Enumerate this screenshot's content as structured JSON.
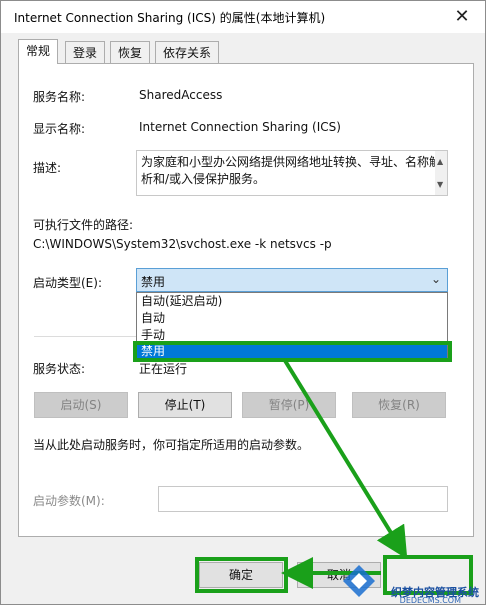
{
  "window": {
    "title": "Internet Connection Sharing (ICS) 的属性(本地计算机)",
    "close_glyph": "✕"
  },
  "tabs": [
    {
      "label": "常规",
      "active": true
    },
    {
      "label": "登录",
      "active": false
    },
    {
      "label": "恢复",
      "active": false
    },
    {
      "label": "依存关系",
      "active": false
    }
  ],
  "general": {
    "service_name_label": "服务名称:",
    "service_name_value": "SharedAccess",
    "display_name_label": "显示名称:",
    "display_name_value": "Internet Connection Sharing (ICS)",
    "description_label": "描述:",
    "description_value": "为家庭和小型办公网络提供网络地址转换、寻址、名称解析和/或入侵保护服务。",
    "path_label": "可执行文件的路径:",
    "path_value": "C:\\WINDOWS\\System32\\svchost.exe -k netsvcs -p",
    "startup_type_label": "启动类型(E):",
    "startup_type_value": "禁用",
    "startup_options": [
      "自动(延迟启动)",
      "自动",
      "手动",
      "禁用"
    ],
    "service_status_label": "服务状态:",
    "service_status_value": "正在运行",
    "start_button": "启动(S)",
    "stop_button": "停止(T)",
    "pause_button": "暂停(P)",
    "resume_button": "恢复(R)",
    "hint_text": "当从此处启动服务时，你可指定所适用的启动参数。",
    "start_params_label": "启动参数(M):"
  },
  "footer": {
    "ok_button": "确定",
    "cancel_button": "取消"
  },
  "watermark": {
    "text": "织梦内容管理系统",
    "url": "DEDECMS.COM"
  },
  "colors": {
    "accent_highlight": "#1aa01a",
    "selection": "#0078d7"
  }
}
